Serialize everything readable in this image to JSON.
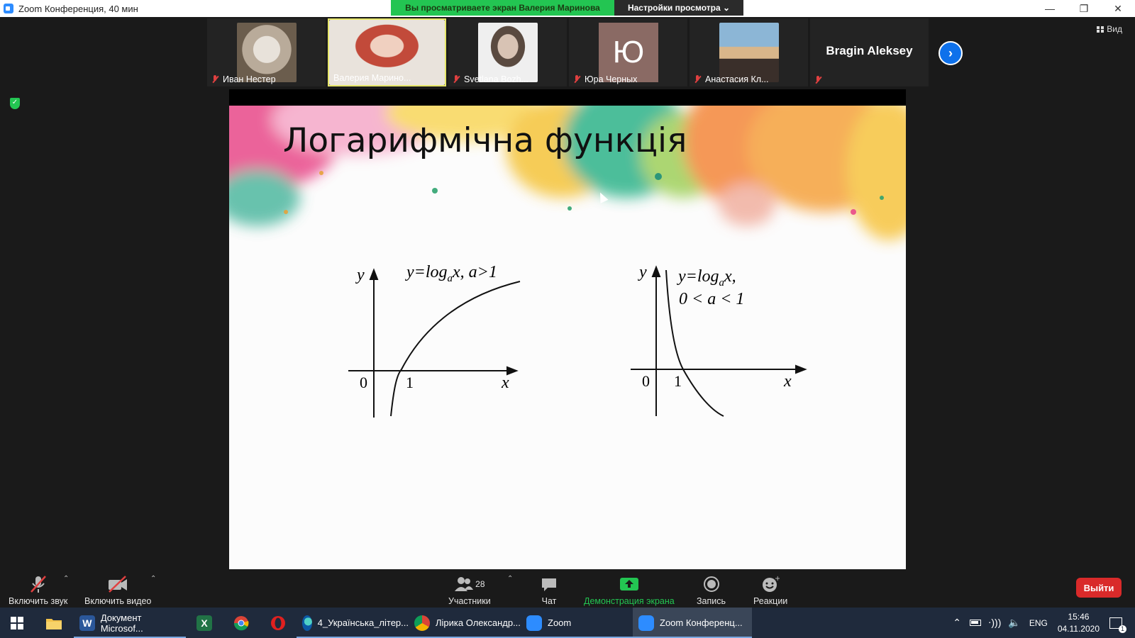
{
  "window": {
    "title": "Zoom Конференция, 40 мин"
  },
  "share_banner": {
    "viewing_text": "Вы просматриваете экран Валерия Маринова",
    "view_options": "Настройки просмотра ⌄"
  },
  "participants": [
    {
      "name": "Иван Нестер",
      "muted": true
    },
    {
      "name": "Валерия Марино...",
      "muted": false
    },
    {
      "name": "Svetlana Bozh...",
      "muted": true
    },
    {
      "name": "Юра Черных",
      "muted": true,
      "initial": "Ю"
    },
    {
      "name": "Анастасия Кл...",
      "muted": true
    },
    {
      "name": "Bragin Aleksey",
      "muted": true
    }
  ],
  "view_button": "Вид",
  "slide": {
    "title": "Логарифмічна функція",
    "graph_left": {
      "formula": "y=log",
      "sub": "a",
      "rest": "x, a>1",
      "y": "y",
      "x": "x",
      "zero": "0",
      "one": "1"
    },
    "graph_right": {
      "formula": "y=log",
      "sub": "a",
      "rest": "x,",
      "cond": "0 < a < 1",
      "y": "y",
      "x": "x",
      "zero": "0",
      "one": "1"
    }
  },
  "toolbar": {
    "audio": "Включить звук",
    "video": "Включить видео",
    "participants": "Участники",
    "participants_count": "28",
    "chat": "Чат",
    "share": "Демонстрация экрана",
    "record": "Запись",
    "reactions": "Реакции",
    "leave": "Выйти"
  },
  "taskbar": {
    "apps": [
      "Документ Microsof...",
      "4_Українська_літер...",
      "Лірика Олександр...",
      "Zoom",
      "Zoom Конференц..."
    ],
    "lang": "ENG",
    "time": "15:46",
    "date": "04.11.2020",
    "notifications": "1"
  },
  "colors": {
    "zoom_blue": "#0e71eb",
    "banner_green": "#23c552",
    "leave_red": "#d92a2a"
  }
}
